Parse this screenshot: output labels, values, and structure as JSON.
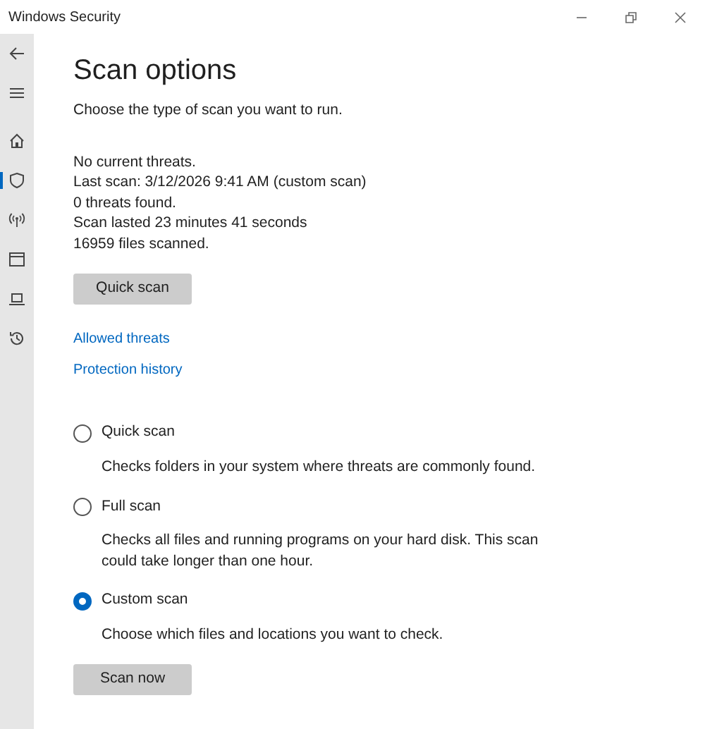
{
  "window": {
    "title": "Windows Security"
  },
  "sidebar": {
    "items": [
      {
        "kind": "back",
        "selected": false
      },
      {
        "kind": "menu",
        "selected": false
      },
      {
        "kind": "home",
        "selected": false
      },
      {
        "kind": "shield",
        "selected": true
      },
      {
        "kind": "antenna",
        "selected": false
      },
      {
        "kind": "browser",
        "selected": false
      },
      {
        "kind": "laptop",
        "selected": false
      },
      {
        "kind": "history",
        "selected": false
      }
    ]
  },
  "page": {
    "title": "Scan options",
    "subtitle": "Choose the type of scan you want to run.",
    "status": [
      "No current threats.",
      "Last scan: 3/12/2026 9:41 AM (custom scan)",
      "0 threats found.",
      "Scan lasted 23 minutes 41 seconds",
      "16959 files scanned."
    ],
    "quick_button": "Quick scan",
    "links": [
      "Allowed threats",
      "Protection history"
    ],
    "options": [
      {
        "label": "Quick scan",
        "description": "Checks folders in your system where threats are commonly found.",
        "selected": false
      },
      {
        "label": "Full scan",
        "description": "Checks all files and running programs on your hard disk. This scan could take longer than one hour.",
        "selected": false
      },
      {
        "label": "Custom scan",
        "description": "Choose which files and locations you want to check.",
        "selected": true
      }
    ],
    "scan_button": "Scan now"
  }
}
